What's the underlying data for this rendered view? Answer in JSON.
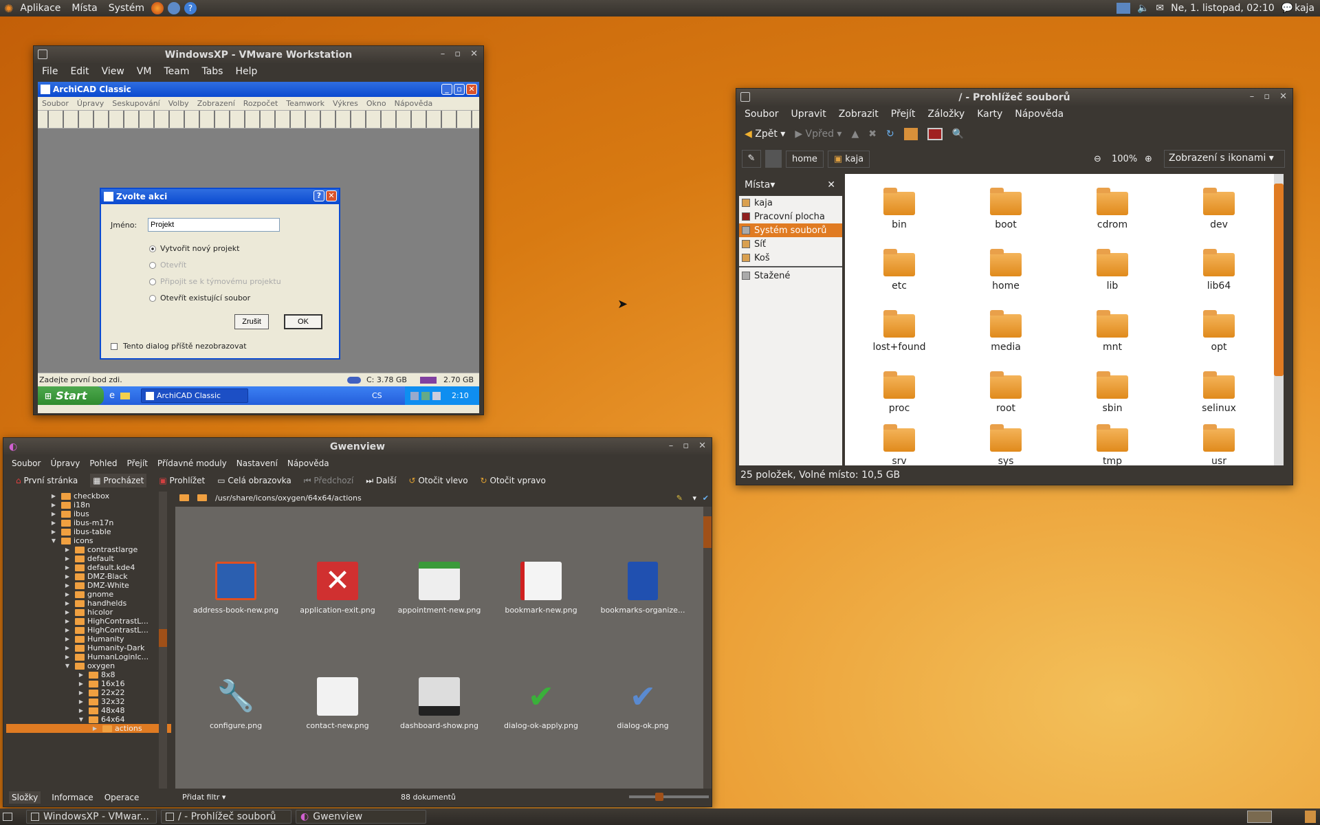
{
  "topbar": {
    "menu": [
      "Aplikace",
      "Místa",
      "Systém"
    ],
    "datetime": "Ne,  1. listopad, 02:10",
    "user": "kaja"
  },
  "vmware": {
    "title": "WindowsXP - VMware Workstation",
    "menu": [
      "File",
      "Edit",
      "View",
      "VM",
      "Team",
      "Tabs",
      "Help"
    ],
    "archicad": {
      "title": "ArchiCAD Classic",
      "menu": [
        "Soubor",
        "Úpravy",
        "Seskupování",
        "Volby",
        "Zobrazení",
        "Rozpočet",
        "Teamwork",
        "Výkres",
        "Okno",
        "Nápověda"
      ],
      "status": "Zadejte první bod zdi.",
      "disk": "C: 3.78 GB",
      "mem": "2.70 GB"
    },
    "dialog": {
      "title": "Zvolte akci",
      "name_label": "Jméno:",
      "name_value": "Projekt",
      "options": [
        "Vytvořit nový projekt",
        "Otevřít",
        "Připojit se k týmovému projektu",
        "Otevřít existující soubor"
      ],
      "cancel": "Zrušit",
      "ok": "OK",
      "checkbox": "Tento dialog příště nezobrazovat"
    },
    "xp_taskbar": {
      "start": "Start",
      "task": "ArchiCAD Classic",
      "lang": "CS",
      "clock": "2:10"
    }
  },
  "nautilus": {
    "title": "/ - Prohlížeč souborů",
    "menu": [
      "Soubor",
      "Upravit",
      "Zobrazit",
      "Přejít",
      "Záložky",
      "Karty",
      "Nápověda"
    ],
    "back": "Zpět",
    "forward": "Vpřed",
    "path": [
      "home",
      "kaja"
    ],
    "zoom": "100%",
    "view": "Zobrazení s ikonami",
    "places_label": "Místa",
    "places": [
      "kaja",
      "Pracovní plocha",
      "Systém souborů",
      "Síť",
      "Koš",
      "Stažené"
    ],
    "files": [
      "bin",
      "boot",
      "cdrom",
      "dev",
      "etc",
      "home",
      "lib",
      "lib64",
      "lost+found",
      "media",
      "mnt",
      "opt",
      "proc",
      "root",
      "sbin",
      "selinux",
      "srv",
      "sys",
      "tmp",
      "usr"
    ],
    "status": "25 položek, Volné místo: 10,5 GB"
  },
  "gwenview": {
    "title": "Gwenview",
    "menu": [
      "Soubor",
      "Úpravy",
      "Pohled",
      "Přejít",
      "Přídavné moduly",
      "Nastavení",
      "Nápověda"
    ],
    "toolbar": [
      "První stránka",
      "Procházet",
      "Prohlížet",
      "Celá obrazovka",
      "Předchozí",
      "Další",
      "Otočit vlevo",
      "Otočit vpravo"
    ],
    "path": "/usr/share/icons/oxygen/64x64/actions",
    "tree": [
      "checkbox",
      "i18n",
      "ibus",
      "ibus-m17n",
      "ibus-table",
      "icons",
      "contrastlarge",
      "default",
      "default.kde4",
      "DMZ-Black",
      "DMZ-White",
      "gnome",
      "handhelds",
      "hicolor",
      "HighContrastL...",
      "HighContrastL...",
      "Humanity",
      "Humanity-Dark",
      "HumanLoginIc...",
      "oxygen",
      "8x8",
      "16x16",
      "22x22",
      "32x32",
      "48x48",
      "64x64",
      "actions"
    ],
    "thumbs": [
      "address-book-new.png",
      "application-exit.png",
      "appointment-new.png",
      "bookmark-new.png",
      "bookmarks-organize...",
      "configure.png",
      "contact-new.png",
      "dashboard-show.png",
      "dialog-ok-apply.png",
      "dialog-ok.png"
    ],
    "tabs": [
      "Složky",
      "Informace",
      "Operace"
    ],
    "filter": "Přidat filtr",
    "count": "88 dokumentů"
  },
  "taskbar": [
    "WindowsXP - VMwar...",
    "/ - Prohlížeč souborů",
    "Gwenview"
  ]
}
